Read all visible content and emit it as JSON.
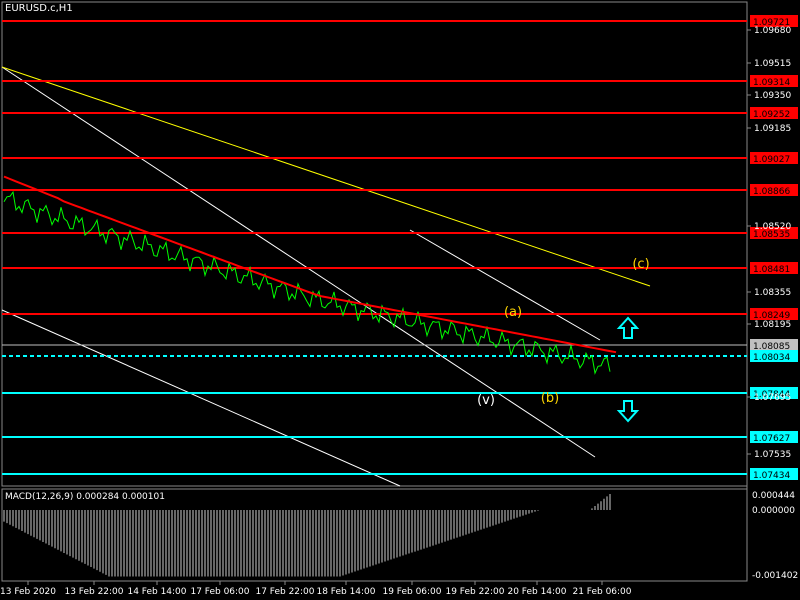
{
  "header": {
    "symbol": "EURUSD.c,H1"
  },
  "macd": {
    "title": "MACD(12,26,9) 0.000284 0.000101",
    "ticks": [
      "0.000444",
      "0.000000",
      "-0.001402"
    ]
  },
  "price_axis": {
    "ticks": [
      "1.09680",
      "1.09515",
      "1.09350",
      "1.09185",
      "1.08520",
      "1.08355",
      "1.08195",
      "1.07695",
      "1.07535"
    ]
  },
  "levels": [
    {
      "label": "1.09721",
      "color": "#ff0000"
    },
    {
      "label": "1.09314",
      "color": "#ff0000"
    },
    {
      "label": "1.09252",
      "color": "#ff0000"
    },
    {
      "label": "1.09027",
      "color": "#ff0000"
    },
    {
      "label": "1.08866",
      "color": "#ff0000"
    },
    {
      "label": "1.08535",
      "color": "#ff0000"
    },
    {
      "label": "1.08481",
      "color": "#ff0000"
    },
    {
      "label": "1.08249",
      "color": "#ff0000"
    },
    {
      "label": "1.08085",
      "color": "#c0c0c0"
    },
    {
      "label": "1.08034",
      "color": "#00ffff"
    },
    {
      "label": "1.07844",
      "color": "#00ffff"
    },
    {
      "label": "1.07627",
      "color": "#00ffff"
    },
    {
      "label": "1.07434",
      "color": "#00ffff"
    }
  ],
  "waves": [
    {
      "label": "(a)",
      "color": "#ffd700"
    },
    {
      "label": "(b)",
      "color": "#ffd700"
    },
    {
      "label": "(c)",
      "color": "#ffd700"
    },
    {
      "label": "(v)",
      "color": "#ffffff"
    }
  ],
  "time_axis": [
    "13 Feb 2020",
    "13 Feb 22:00",
    "14 Feb 14:00",
    "17 Feb 06:00",
    "17 Feb 22:00",
    "18 Feb 14:00",
    "19 Feb 06:00",
    "19 Feb 22:00",
    "20 Feb 14:00",
    "21 Feb 06:00"
  ],
  "colors": {
    "support": "#00ffff",
    "resistance": "#ff0000",
    "price": "#00ff00",
    "ma": "#ff0000",
    "channel": "#ffffff",
    "trend": "#ffff00",
    "arrow": "#00ffff"
  },
  "icons": {
    "up": "arrow-up-icon",
    "down": "arrow-down-icon"
  }
}
